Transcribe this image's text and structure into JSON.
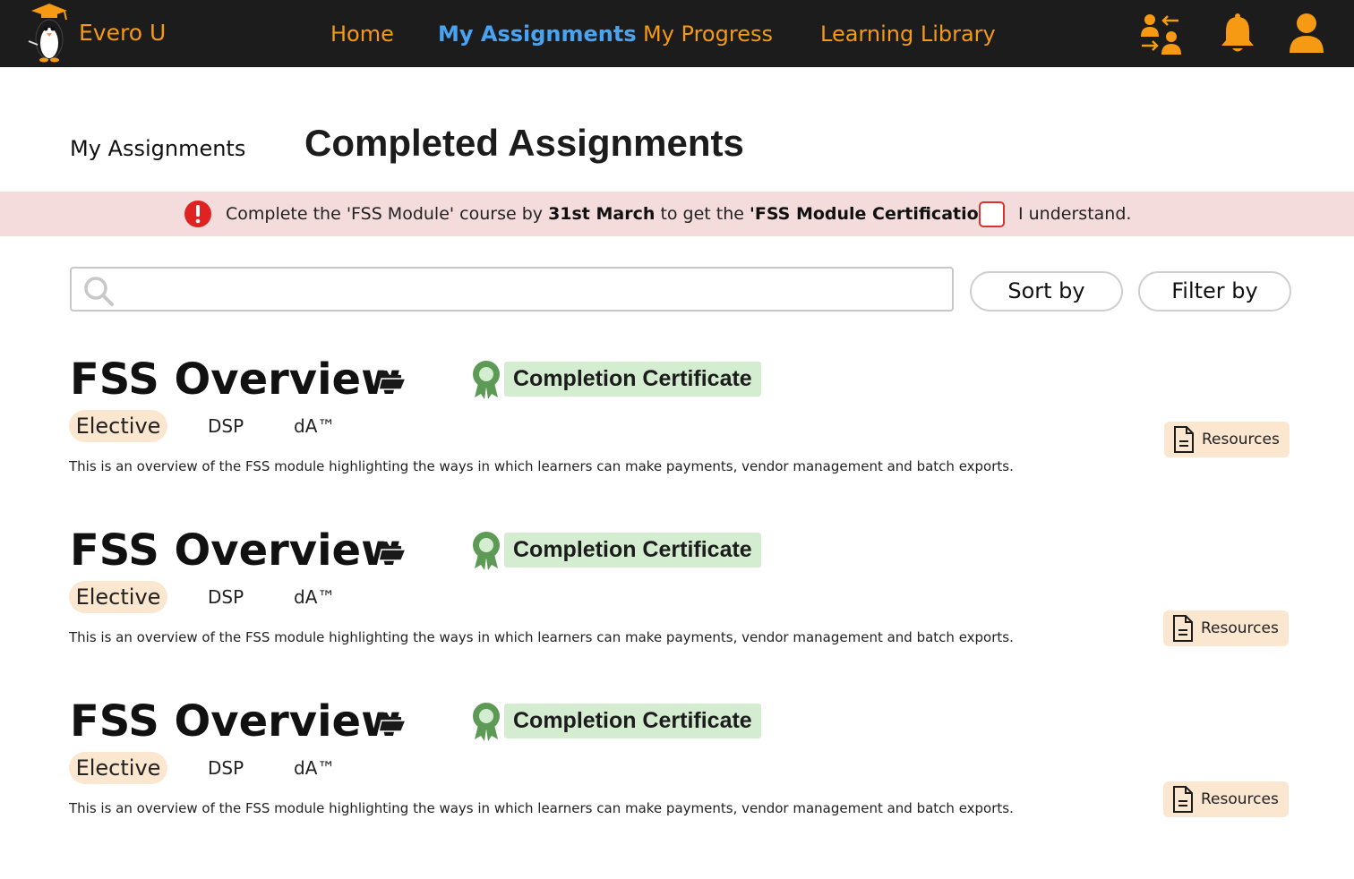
{
  "brand": {
    "name": "Evero U",
    "logo_icon": "penguin-graduate-logo"
  },
  "nav": {
    "links": [
      {
        "label": "Home"
      },
      {
        "label": "My Assignments"
      },
      {
        "label": "My Progress"
      },
      {
        "label": "Learning Library"
      }
    ],
    "active": "My Assignments",
    "icons": [
      "switch-user-icon",
      "bell-icon",
      "user-icon"
    ]
  },
  "header": {
    "breadcrumb": "My Assignments",
    "title": "Completed Assignments"
  },
  "banner": {
    "text_prefix": "Complete the 'FSS Module' course by ",
    "deadline": "31st March",
    "text_middle": " to get the ",
    "certification": "'FSS Module Certification'.",
    "ack_label": "I understand.",
    "ack_checked": false
  },
  "search": {
    "value": "",
    "placeholder": ""
  },
  "controls": {
    "sort_label": "Sort by",
    "filter_label": "Filter by"
  },
  "assignments": [
    {
      "title": "FSS Overview",
      "certificate": "Completion Certificate",
      "tags": [
        "Elective",
        "DSP",
        "dA™"
      ],
      "description": "This is an overview of the FSS module highlighting the ways in which learners can make payments, vendor management and batch exports.",
      "resources_label": "Resources"
    },
    {
      "title": "FSS Overview",
      "certificate": "Completion Certificate",
      "tags": [
        "Elective",
        "DSP",
        "dA™"
      ],
      "description": "This is an overview of the FSS module highlighting the ways in which learners can make payments, vendor management and batch exports.",
      "resources_label": "Resources"
    },
    {
      "title": "FSS Overview",
      "certificate": "Completion Certificate",
      "tags": [
        "Elective",
        "DSP",
        "dA™"
      ],
      "description": "This is an overview of the FSS module highlighting the ways in which learners can make payments, vendor management and batch exports.",
      "resources_label": "Resources"
    }
  ],
  "colors": {
    "topbar_bg": "#1c1c1c",
    "nav_accent": "#f59a12",
    "nav_active": "#4aa3f0",
    "banner_bg": "#f5dcdc",
    "alert_red": "#e02222",
    "certificate_bg": "#d4ecd0",
    "certificate_icon": "#5c9a55",
    "tag_bg": "#fbe6d0"
  }
}
